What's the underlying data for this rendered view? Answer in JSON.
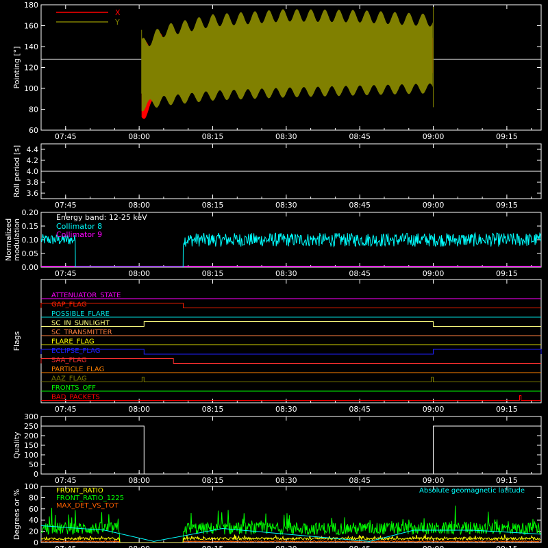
{
  "time_ticks": [
    "07:45",
    "08:00",
    "08:15",
    "08:30",
    "08:45",
    "09:00",
    "09:15"
  ],
  "colors": {
    "background": "#000000",
    "axes": "#ffffff",
    "x": "#ff0000",
    "y": "#808000",
    "cyan": "#00ffff",
    "magenta": "#ff00ff",
    "green": "#00ff00",
    "yellow": "#ffff00"
  },
  "chart_data": [
    {
      "type": "area",
      "ylabel": "Pointing [°]",
      "ylim": [
        60,
        180
      ],
      "yticks": [
        60,
        80,
        100,
        120,
        140,
        160,
        180
      ],
      "x_range": [
        "07:40",
        "09:22"
      ],
      "reference_line": 128,
      "legend": [
        "X",
        "Y"
      ],
      "legend_placement": "top-left",
      "series": [
        {
          "name": "X",
          "color": "#ff0000",
          "x": [
            "08:00",
            "08:05",
            "08:15",
            "08:30",
            "08:45",
            "09:00"
          ],
          "upper": [
            135,
            150,
            157,
            160,
            158,
            154
          ],
          "lower": [
            70,
            95,
            110,
            118,
            114,
            110
          ]
        },
        {
          "name": "Y",
          "color": "#808000",
          "x": [
            "08:00",
            "08:05",
            "08:15",
            "08:30",
            "08:45",
            "09:00"
          ],
          "upper": [
            140,
            155,
            165,
            170,
            169,
            165
          ],
          "lower": [
            82,
            88,
            93,
            96,
            98,
            100
          ]
        }
      ]
    },
    {
      "type": "line",
      "ylabel": "Roll period [s]",
      "ylim": [
        3.5,
        4.5
      ],
      "yticks": [
        3.6,
        3.8,
        4.0,
        4.2,
        4.4
      ],
      "x_range": [
        "07:40",
        "09:22"
      ],
      "series": [
        {
          "color": "#ffffff",
          "x": [
            "07:40",
            "09:22"
          ],
          "y": [
            4.0,
            4.0
          ]
        }
      ]
    },
    {
      "type": "line",
      "ylabel": "Normalized\nmodulation",
      "ylim": [
        0,
        0.2
      ],
      "yticks": [
        0.0,
        0.05,
        0.1,
        0.15,
        0.2
      ],
      "x_range": [
        "07:40",
        "09:22"
      ],
      "annotation": "Energy band: 12-25 keV",
      "legend": [
        "Collimator 8",
        "Collimator 9"
      ],
      "series": [
        {
          "name": "Collimator 8",
          "color": "#00ffff",
          "segments": [
            {
              "from": "07:40",
              "to": "07:47",
              "level": 0.1,
              "noise": 0.02
            },
            {
              "from": "07:47",
              "to": "08:09",
              "level": 0.0,
              "noise": 0
            },
            {
              "from": "08:09",
              "to": "09:22",
              "level": 0.1,
              "noise": 0.025
            }
          ]
        },
        {
          "name": "Collimator 9",
          "color": "#ff00ff",
          "segments": [
            {
              "from": "07:40",
              "to": "09:22",
              "level": 0.0,
              "noise": 0
            }
          ]
        }
      ]
    },
    {
      "type": "line",
      "ylabel": "Flags",
      "x_range": [
        "07:40",
        "09:22"
      ],
      "flags": [
        {
          "name": "ATTENUATOR_STATE",
          "color": "#ff00ff",
          "high": []
        },
        {
          "name": "GAP_FLAG",
          "color": "#ff2000",
          "high": [
            [
              "07:40",
              "08:09"
            ]
          ]
        },
        {
          "name": "POSSIBLE_FLARE",
          "color": "#00e0e0",
          "high": []
        },
        {
          "name": "SC_IN_SUNLIGHT",
          "color": "#ffff80",
          "high": [
            [
              "08:01",
              "09:00"
            ]
          ]
        },
        {
          "name": "SC_TRANSMITTER",
          "color": "#ff8040",
          "high": []
        },
        {
          "name": "FLARE_FLAG",
          "color": "#ffff00",
          "high": []
        },
        {
          "name": "ECLIPSE_FLAG",
          "color": "#2020ff",
          "high": [
            [
              "07:40",
              "08:01"
            ],
            [
              "09:00",
              "09:22"
            ]
          ]
        },
        {
          "name": "SAA_FLAG",
          "color": "#ff3030",
          "high": [
            [
              "07:40",
              "08:07"
            ]
          ]
        },
        {
          "name": "PARTICLE_FLAG",
          "color": "#ff8000",
          "high": []
        },
        {
          "name": "AAZ_FLAG",
          "color": "#808000",
          "high": [
            [
              "08:00.6",
              "08:01"
            ],
            [
              "08:59.6",
              "09:00"
            ]
          ]
        },
        {
          "name": "FRONTS_OFF",
          "color": "#00ff00",
          "high": []
        },
        {
          "name": "BAD_PACKETS",
          "color": "#ff0000",
          "high": [
            [
              "09:17.6",
              "09:17.9"
            ]
          ]
        }
      ]
    },
    {
      "type": "line",
      "ylabel": "Quality",
      "ylim": [
        0,
        300
      ],
      "yticks": [
        0,
        50,
        100,
        150,
        200,
        250,
        300
      ],
      "x_range": [
        "07:40",
        "09:22"
      ],
      "series": [
        {
          "color": "#ffffff",
          "x": [
            "07:40",
            "08:01",
            "08:01",
            "09:00",
            "09:00",
            "09:22"
          ],
          "y": [
            250,
            250,
            0,
            0,
            250,
            250
          ]
        }
      ]
    },
    {
      "type": "line",
      "ylabel": "Degrees or %",
      "ylim": [
        0,
        100
      ],
      "yticks": [
        0,
        20,
        40,
        60,
        80,
        100
      ],
      "x_range": [
        "07:40",
        "09:22"
      ],
      "legend": [
        "FRONT_RATIO",
        "FRONT_RATIO_1225",
        "MAX_DET_VS_TOT"
      ],
      "annotation": "Absolute geomagnetic latitude",
      "series": [
        {
          "name": "FRONT_RATIO",
          "color": "#ffff00",
          "level": 7
        },
        {
          "name": "FRONT_RATIO_1225",
          "color": "#00ff00",
          "level": 25
        },
        {
          "name": "MAX_DET_VS_TOT",
          "color": "#ff6000",
          "level": 2
        },
        {
          "name": "Absolute geomagnetic latitude",
          "color": "#00ffff",
          "x": [
            "07:40",
            "07:53",
            "08:03",
            "08:17",
            "08:30",
            "08:47",
            "08:56",
            "09:08",
            "09:22"
          ],
          "y": [
            30,
            22,
            2,
            25,
            15,
            2,
            22,
            22,
            15
          ]
        }
      ]
    }
  ]
}
